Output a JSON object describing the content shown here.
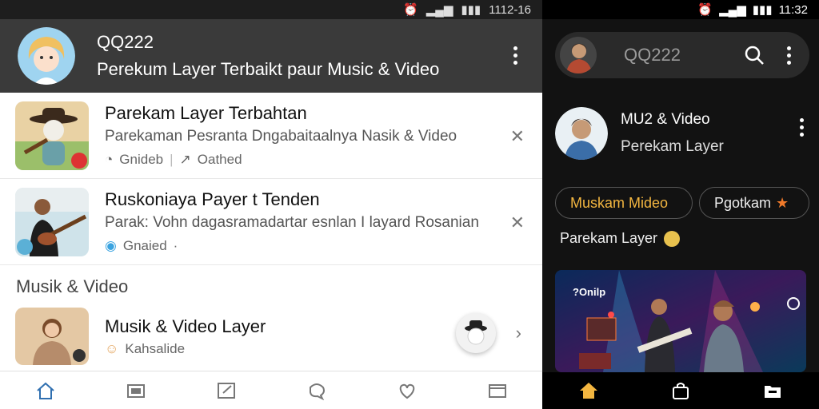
{
  "left": {
    "status": {
      "time": "1112-16"
    },
    "header": {
      "title": "QQ222",
      "subtitle": "Perekum Layer Terbaikt paur Music & Video"
    },
    "items": [
      {
        "title": "Parekam Layer Terbahtan",
        "desc": "Parekaman Pesranta Dngabaitaalnya Nasik & Video",
        "meta1": "Gnideb",
        "meta2": "Oathed"
      },
      {
        "title": "Ruskoniaya Payer t Tenden",
        "desc": "Parak: Vohn dagasramadartar esnlan I layard Rosanian",
        "meta1": "Gnaied",
        "meta2": "·"
      }
    ],
    "section_label": "Musik & Video",
    "last_item": {
      "title": "Musik & Video Layer",
      "meta": "Kahsalide"
    },
    "nav_icons": [
      "home-icon",
      "gallery-icon",
      "edit-icon",
      "chat-icon",
      "heart-icon",
      "window-icon"
    ]
  },
  "right": {
    "status": {
      "time": "11:32"
    },
    "search": {
      "query": "QQ222"
    },
    "profile": {
      "line1": "MU2 & Video",
      "line2": "Perekam Layer"
    },
    "chips": [
      "Muskam Mideo",
      "Pgotkam"
    ],
    "pill_label": "Parekam Layer",
    "video_label": "?Onilp",
    "nav_icons": [
      "home-icon",
      "bag-icon",
      "folder-icon"
    ]
  },
  "colors": {
    "accent": "#f3b640",
    "dark_bg": "#121212",
    "light_appbar": "#3a3a3a"
  }
}
